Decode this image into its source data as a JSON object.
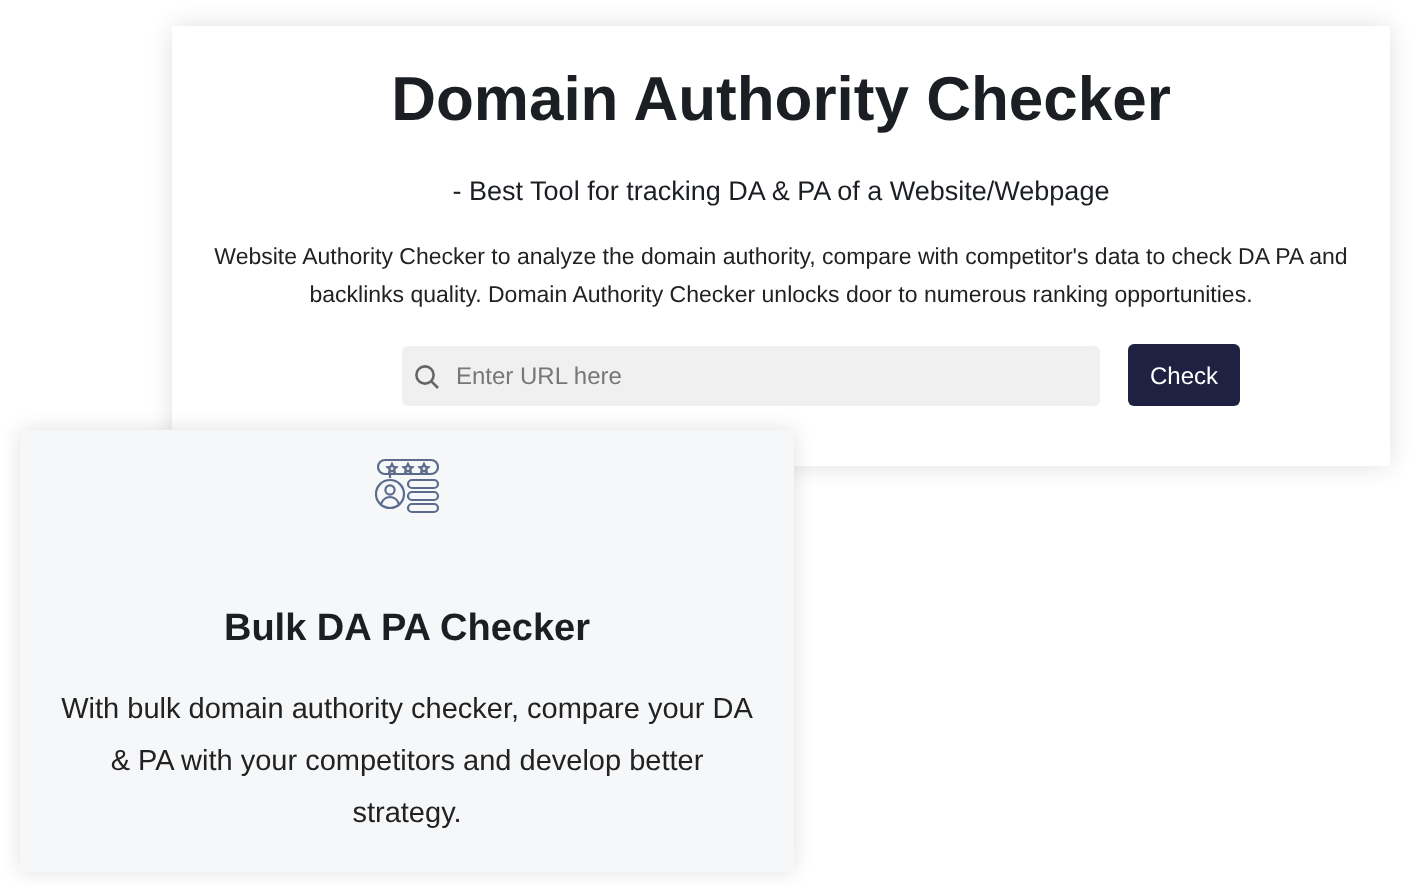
{
  "checker": {
    "title": "Domain Authority Checker",
    "subtitle": "- Best Tool for tracking DA & PA of a Website/Webpage",
    "description": "Website Authority Checker to analyze the domain authority, compare with competitor's data to check DA PA and backlinks quality. Domain Authority Checker unlocks door to numerous ranking opportunities.",
    "search": {
      "placeholder": "Enter URL here"
    },
    "button": "Check"
  },
  "bulk_card": {
    "title": "Bulk DA PA Checker",
    "description": "With bulk domain authority checker, compare your DA & PA with your competitors and develop better strategy."
  }
}
